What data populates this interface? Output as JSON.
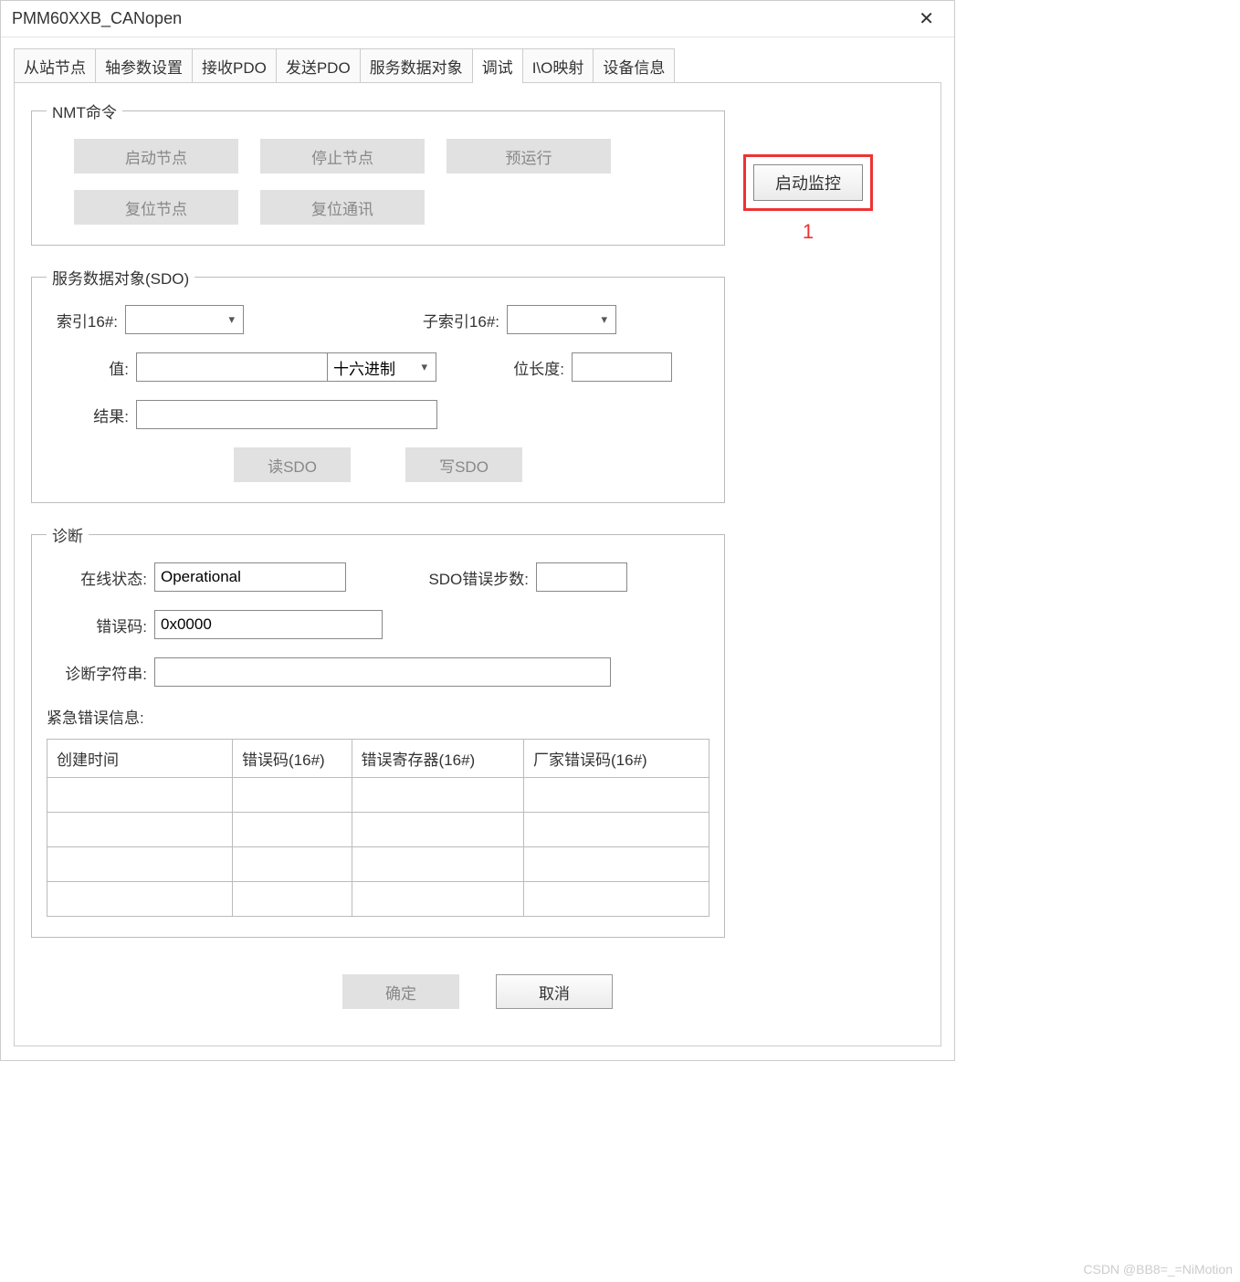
{
  "title": "PMM60XXB_CANopen",
  "tabs": [
    "从站节点",
    "轴参数设置",
    "接收PDO",
    "发送PDO",
    "服务数据对象",
    "调试",
    "I\\O映射",
    "设备信息"
  ],
  "active_tab_index": 5,
  "nmt": {
    "legend": "NMT命令",
    "start_node": "启动节点",
    "stop_node": "停止节点",
    "pre_op": "预运行",
    "reset_node": "复位节点",
    "reset_comm": "复位通讯"
  },
  "side": {
    "start_monitor": "启动监控",
    "annotation": "1"
  },
  "sdo": {
    "legend": "服务数据对象(SDO)",
    "index_label": "索引16#:",
    "index_value": "",
    "subindex_label": "子索引16#:",
    "subindex_value": "",
    "value_label": "值:",
    "value_value": "",
    "format_value": "十六进制",
    "bitlen_label": "位长度:",
    "bitlen_value": "",
    "result_label": "结果:",
    "result_value": "",
    "read_btn": "读SDO",
    "write_btn": "写SDO"
  },
  "diag": {
    "legend": "诊断",
    "online_label": "在线状态:",
    "online_value": "Operational",
    "sdo_err_steps_label": "SDO错误步数:",
    "sdo_err_steps_value": "",
    "errcode_label": "错误码:",
    "errcode_value": "0x0000",
    "diagstr_label": "诊断字符串:",
    "diagstr_value": "",
    "emergency_label": "紧急错误信息:",
    "table_headers": [
      "创建时间",
      "错误码(16#)",
      "错误寄存器(16#)",
      "厂家错误码(16#)"
    ],
    "table_rows": [
      [
        "",
        "",
        "",
        ""
      ],
      [
        "",
        "",
        "",
        ""
      ],
      [
        "",
        "",
        "",
        ""
      ],
      [
        "",
        "",
        "",
        ""
      ]
    ]
  },
  "buttons": {
    "ok": "确定",
    "cancel": "取消"
  },
  "watermark": "CSDN @BB8=_=NiMotion"
}
